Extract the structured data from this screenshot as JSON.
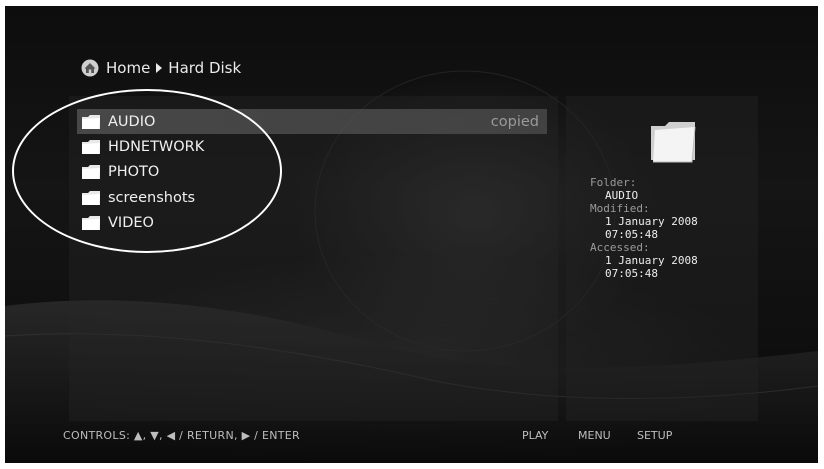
{
  "breadcrumb": {
    "home_icon": "home-icon",
    "home": "Home",
    "separator_icon": "triangle-right-icon",
    "current": "Hard Disk"
  },
  "files": [
    {
      "name": "AUDIO",
      "icon": "folder-icon",
      "selected": true,
      "status": "copied"
    },
    {
      "name": "HDNETWORK",
      "icon": "folder-icon"
    },
    {
      "name": "PHOTO",
      "icon": "folder-icon"
    },
    {
      "name": "screenshots",
      "icon": "folder-icon"
    },
    {
      "name": "VIDEO",
      "icon": "folder-icon"
    }
  ],
  "info": {
    "icon": "open-folder-icon",
    "folder_label": "Folder:",
    "folder_value": "AUDIO",
    "modified_label": "Modified:",
    "modified_date": "1 January 2008",
    "modified_time": "07:05:48",
    "accessed_label": "Accessed:",
    "accessed_date": "1 January 2008",
    "accessed_time": "07:05:48"
  },
  "footer": {
    "controls": "CONTROLS:  ▲, ▼, ◀ / RETURN, ▶ / ENTER",
    "play": "PLAY",
    "menu": "MENU",
    "setup": "SETUP"
  },
  "colors": {
    "background": "#0d0d0d",
    "selected_row": "#6e6e6e",
    "text": "#f0f0f0",
    "muted_text": "#9a9a9a",
    "annotation": "#ffffff"
  }
}
